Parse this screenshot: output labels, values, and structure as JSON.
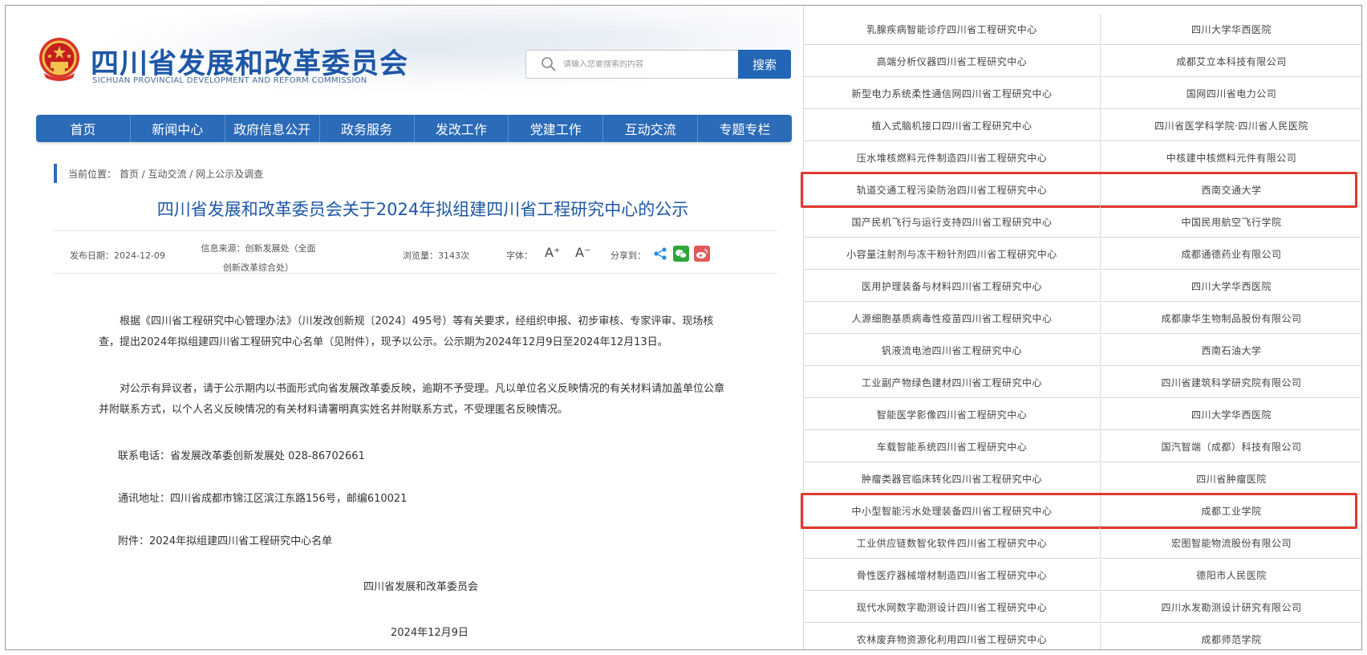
{
  "header": {
    "site_title": "四川省发展和改革委员会",
    "site_subtitle": "SICHUAN PROVINCIAL DEVELOPMENT AND REFORM COMMISSION",
    "search_placeholder": "请输入您要搜索的内容",
    "search_button": "搜索"
  },
  "nav": {
    "items": [
      "首页",
      "新闻中心",
      "政府信息公开",
      "政务服务",
      "发改工作",
      "党建工作",
      "互动交流",
      "专题专栏"
    ]
  },
  "breadcrumb": "当前位置： 首页 / 互动交流 / 网上公示及调查",
  "article": {
    "title": "四川省发展和改革委员会关于2024年拟组建四川省工程研究中心的公示",
    "meta": {
      "date": "发布日期：2024-12-09",
      "source": "信息来源：创新发展处（全面创新改革综合处）",
      "views": "浏览量：3143次",
      "font_label": "字体：",
      "font_up": "A⁺",
      "font_down": "A⁻",
      "share_label": "分享到："
    },
    "para1": "根据《四川省工程研究中心管理办法》（川发改创新规〔2024〕495号）等有关要求，经组织申报、初步审核、专家评审、现场核查，提出2024年拟组建四川省工程研究中心名单（见附件），现予以公示。公示期为2024年12月9日至2024年12月13日。",
    "para2": "对公示有异议者，请于公示期内以书面形式向省发展改革委反映，逾期不予受理。凡以单位名义反映情况的有关材料请加盖单位公章并附联系方式，以个人名义反映情况的有关材料请署明真实姓名并附联系方式，不受理匿名反映情况。",
    "phone": "联系电话：省发展改革委创新发展处  028-86702661",
    "address": "通讯地址：四川省成都市锦江区滨江东路156号，邮编610021",
    "attachment": "附件：2024年拟组建四川省工程研究中心名单",
    "sign_org": "四川省发展和改革委员会",
    "sign_date": "2024年12月9日"
  },
  "table": {
    "rows": [
      {
        "name": "乳腺疾病智能诊疗四川省工程研究中心",
        "org": "四川大学华西医院",
        "highlight": false
      },
      {
        "name": "高端分析仪器四川省工程研究中心",
        "org": "成都艾立本科技有限公司",
        "highlight": false
      },
      {
        "name": "新型电力系统柔性通信网四川省工程研究中心",
        "org": "国网四川省电力公司",
        "highlight": false
      },
      {
        "name": "植入式脑机接口四川省工程研究中心",
        "org": "四川省医学科学院·四川省人民医院",
        "highlight": false
      },
      {
        "name": "压水堆核燃料元件制造四川省工程研究中心",
        "org": "中核建中核燃料元件有限公司",
        "highlight": false
      },
      {
        "name": "轨道交通工程污染防治四川省工程研究中心",
        "org": "西南交通大学",
        "highlight": true
      },
      {
        "name": "国产民机飞行与运行支持四川省工程研究中心",
        "org": "中国民用航空飞行学院",
        "highlight": false
      },
      {
        "name": "小容量注射剂与冻干粉针剂四川省工程研究中心",
        "org": "成都通德药业有限公司",
        "highlight": false
      },
      {
        "name": "医用护理装备与材料四川省工程研究中心",
        "org": "四川大学华西医院",
        "highlight": false
      },
      {
        "name": "人源细胞基质病毒性疫苗四川省工程研究中心",
        "org": "成都康华生物制品股份有限公司",
        "highlight": false
      },
      {
        "name": "钒液流电池四川省工程研究中心",
        "org": "西南石油大学",
        "highlight": false
      },
      {
        "name": "工业副产物绿色建材四川省工程研究中心",
        "org": "四川省建筑科学研究院有限公司",
        "highlight": false
      },
      {
        "name": "智能医学影像四川省工程研究中心",
        "org": "四川大学华西医院",
        "highlight": false
      },
      {
        "name": "车载智能系统四川省工程研究中心",
        "org": "国汽智端（成都）科技有限公司",
        "highlight": false
      },
      {
        "name": "肿瘤类器官临床转化四川省工程研究中心",
        "org": "四川省肿瘤医院",
        "highlight": false
      },
      {
        "name": "中小型智能污水处理装备四川省工程研究中心",
        "org": "成都工业学院",
        "highlight": true
      },
      {
        "name": "工业供应链数智化软件四川省工程研究中心",
        "org": "宏图智能物流股份有限公司",
        "highlight": false
      },
      {
        "name": "骨性医疗器械增材制造四川省工程研究中心",
        "org": "德阳市人民医院",
        "highlight": false
      },
      {
        "name": "现代水网数字勘测设计四川省工程研究中心",
        "org": "四川水发勘测设计研究有限公司",
        "highlight": false
      },
      {
        "name": "农林废弃物资源化利用四川省工程研究中心",
        "org": "成都师范学院",
        "highlight": false
      }
    ]
  },
  "colors": {
    "brand_blue": "#1d57a7",
    "nav_blue": "#2b6bb8",
    "highlight_red": "#e03a2f"
  }
}
